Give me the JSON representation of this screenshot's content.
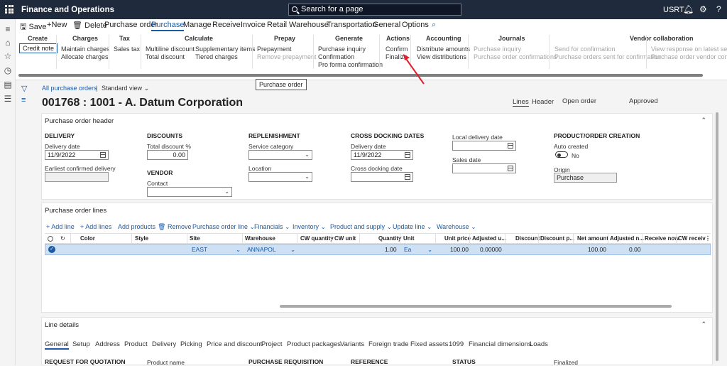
{
  "topbar": {
    "title": "Finance and Operations",
    "search_placeholder": "Search for a page",
    "company": "USRT"
  },
  "actions": {
    "save": "Save",
    "new": "New",
    "delete": "Delete",
    "tabs": [
      "Purchase order",
      "Purchase",
      "Manage",
      "Receive",
      "Invoice",
      "Retail",
      "Warehouse",
      "Transportation",
      "General",
      "Options"
    ],
    "selected_tab": "Purchase"
  },
  "groups": {
    "create": {
      "title": "Create",
      "items": [
        "Credit note"
      ]
    },
    "charges": {
      "title": "Charges",
      "items": [
        "Maintain charges",
        "Allocate charges"
      ]
    },
    "tax": {
      "title": "Tax",
      "items": [
        "Sales tax"
      ]
    },
    "calculate": {
      "title": "Calculate",
      "items": [
        "Multiline discount",
        "Total discount",
        "Supplementary items",
        "Tiered charges"
      ]
    },
    "prepay": {
      "title": "Prepay",
      "items": [
        "Prepayment",
        "Remove prepayment"
      ]
    },
    "generate": {
      "title": "Generate",
      "items": [
        "Purchase inquiry",
        "Confirmation",
        "Pro forma confirmation"
      ]
    },
    "actions": {
      "title": "Actions",
      "items": [
        "Confirm",
        "Finalize"
      ]
    },
    "accounting": {
      "title": "Accounting",
      "items": [
        "Distribute amounts",
        "View distributions"
      ]
    },
    "journals": {
      "title": "Journals",
      "items": [
        "Purchase inquiry",
        "Purchase order confirmations"
      ]
    },
    "vendor": {
      "title": "Vendor collaboration",
      "items": [
        "Send for confirmation",
        "Purchase orders sent for confirmation",
        "View response on latest sent ord",
        "Purchase order vendor confirmat"
      ]
    }
  },
  "tooltip": "Purchase order",
  "breadcrumb": {
    "link": "All purchase orders",
    "view": "Standard view"
  },
  "page": {
    "title": "001768 : 1001 - A. Datum Corporation",
    "tab_lines": "Lines",
    "tab_header": "Header",
    "status": "Open order",
    "approval": "Approved"
  },
  "header_panel": {
    "title": "Purchase order header",
    "delivery": {
      "title": "DELIVERY",
      "date_label": "Delivery date",
      "date_value": "11/9/2022",
      "earliest_label": "Earliest confirmed delivery",
      "earliest_value": ""
    },
    "discounts": {
      "title": "DISCOUNTS",
      "total_label": "Total discount %",
      "total_value": "0.00"
    },
    "vendor": {
      "title": "VENDOR",
      "contact_label": "Contact",
      "contact_value": ""
    },
    "replenishment": {
      "title": "REPLENISHMENT",
      "service_label": "Service category",
      "service_value": "",
      "location_label": "Location",
      "location_value": ""
    },
    "crossdock": {
      "title": "CROSS DOCKING DATES",
      "date_label": "Delivery date",
      "date_value": "11/9/2022",
      "xdock_label": "Cross docking date",
      "xdock_value": ""
    },
    "local": {
      "local_label": "Local delivery date",
      "local_value": "",
      "sales_label": "Sales date",
      "sales_value": ""
    },
    "product": {
      "title": "PRODUCT/ORDER CREATION",
      "auto_label": "Auto created",
      "auto_value": "No",
      "origin_label": "Origin",
      "origin_value": "Purchase"
    }
  },
  "lines_panel": {
    "title": "Purchase order lines",
    "toolbar": [
      "+ Add line",
      "+ Add lines",
      "Add products",
      "Remove",
      "Purchase order line",
      "Financials",
      "Inventory",
      "Product and supply",
      "Update line",
      "Warehouse"
    ],
    "columns": [
      "Color",
      "Style",
      "Site",
      "Warehouse",
      "CW quantity",
      "CW unit",
      "Quantity",
      "Unit",
      "Unit price",
      "Adjusted u...",
      "Discount",
      "Discount p...",
      "Net amount",
      "Adjusted n...",
      "Receive now",
      "CW receiv"
    ],
    "row": {
      "color": "",
      "style": "",
      "site": "EAST",
      "warehouse": "ANNAPOL",
      "cw_quantity": "",
      "cw_unit": "",
      "quantity": "1.00",
      "unit": "Ea",
      "unit_price": "100.00",
      "adjusted_unit": "0.00000",
      "discount": "",
      "discount_p": "",
      "net_amount": "100.00",
      "adjusted_net": "0.00",
      "receive_now": "",
      "cw_receive": ""
    }
  },
  "details_panel": {
    "title": "Line details",
    "tabs": [
      "General",
      "Setup",
      "Address",
      "Product",
      "Delivery",
      "Picking",
      "Price and discount",
      "Project",
      "Product packages",
      "Variants",
      "Foreign trade",
      "Fixed assets",
      "1099",
      "Financial dimensions",
      "Loads"
    ],
    "sections": [
      "REQUEST FOR QUOTATION",
      "Product name",
      "PURCHASE REQUISITION",
      "REFERENCE",
      "STATUS",
      "Finalized"
    ]
  },
  "colors": {
    "accent": "#1b5aa4",
    "topbar": "#1f2a3c",
    "arrow": "#e0202a",
    "row_select": "#cde0f4"
  }
}
